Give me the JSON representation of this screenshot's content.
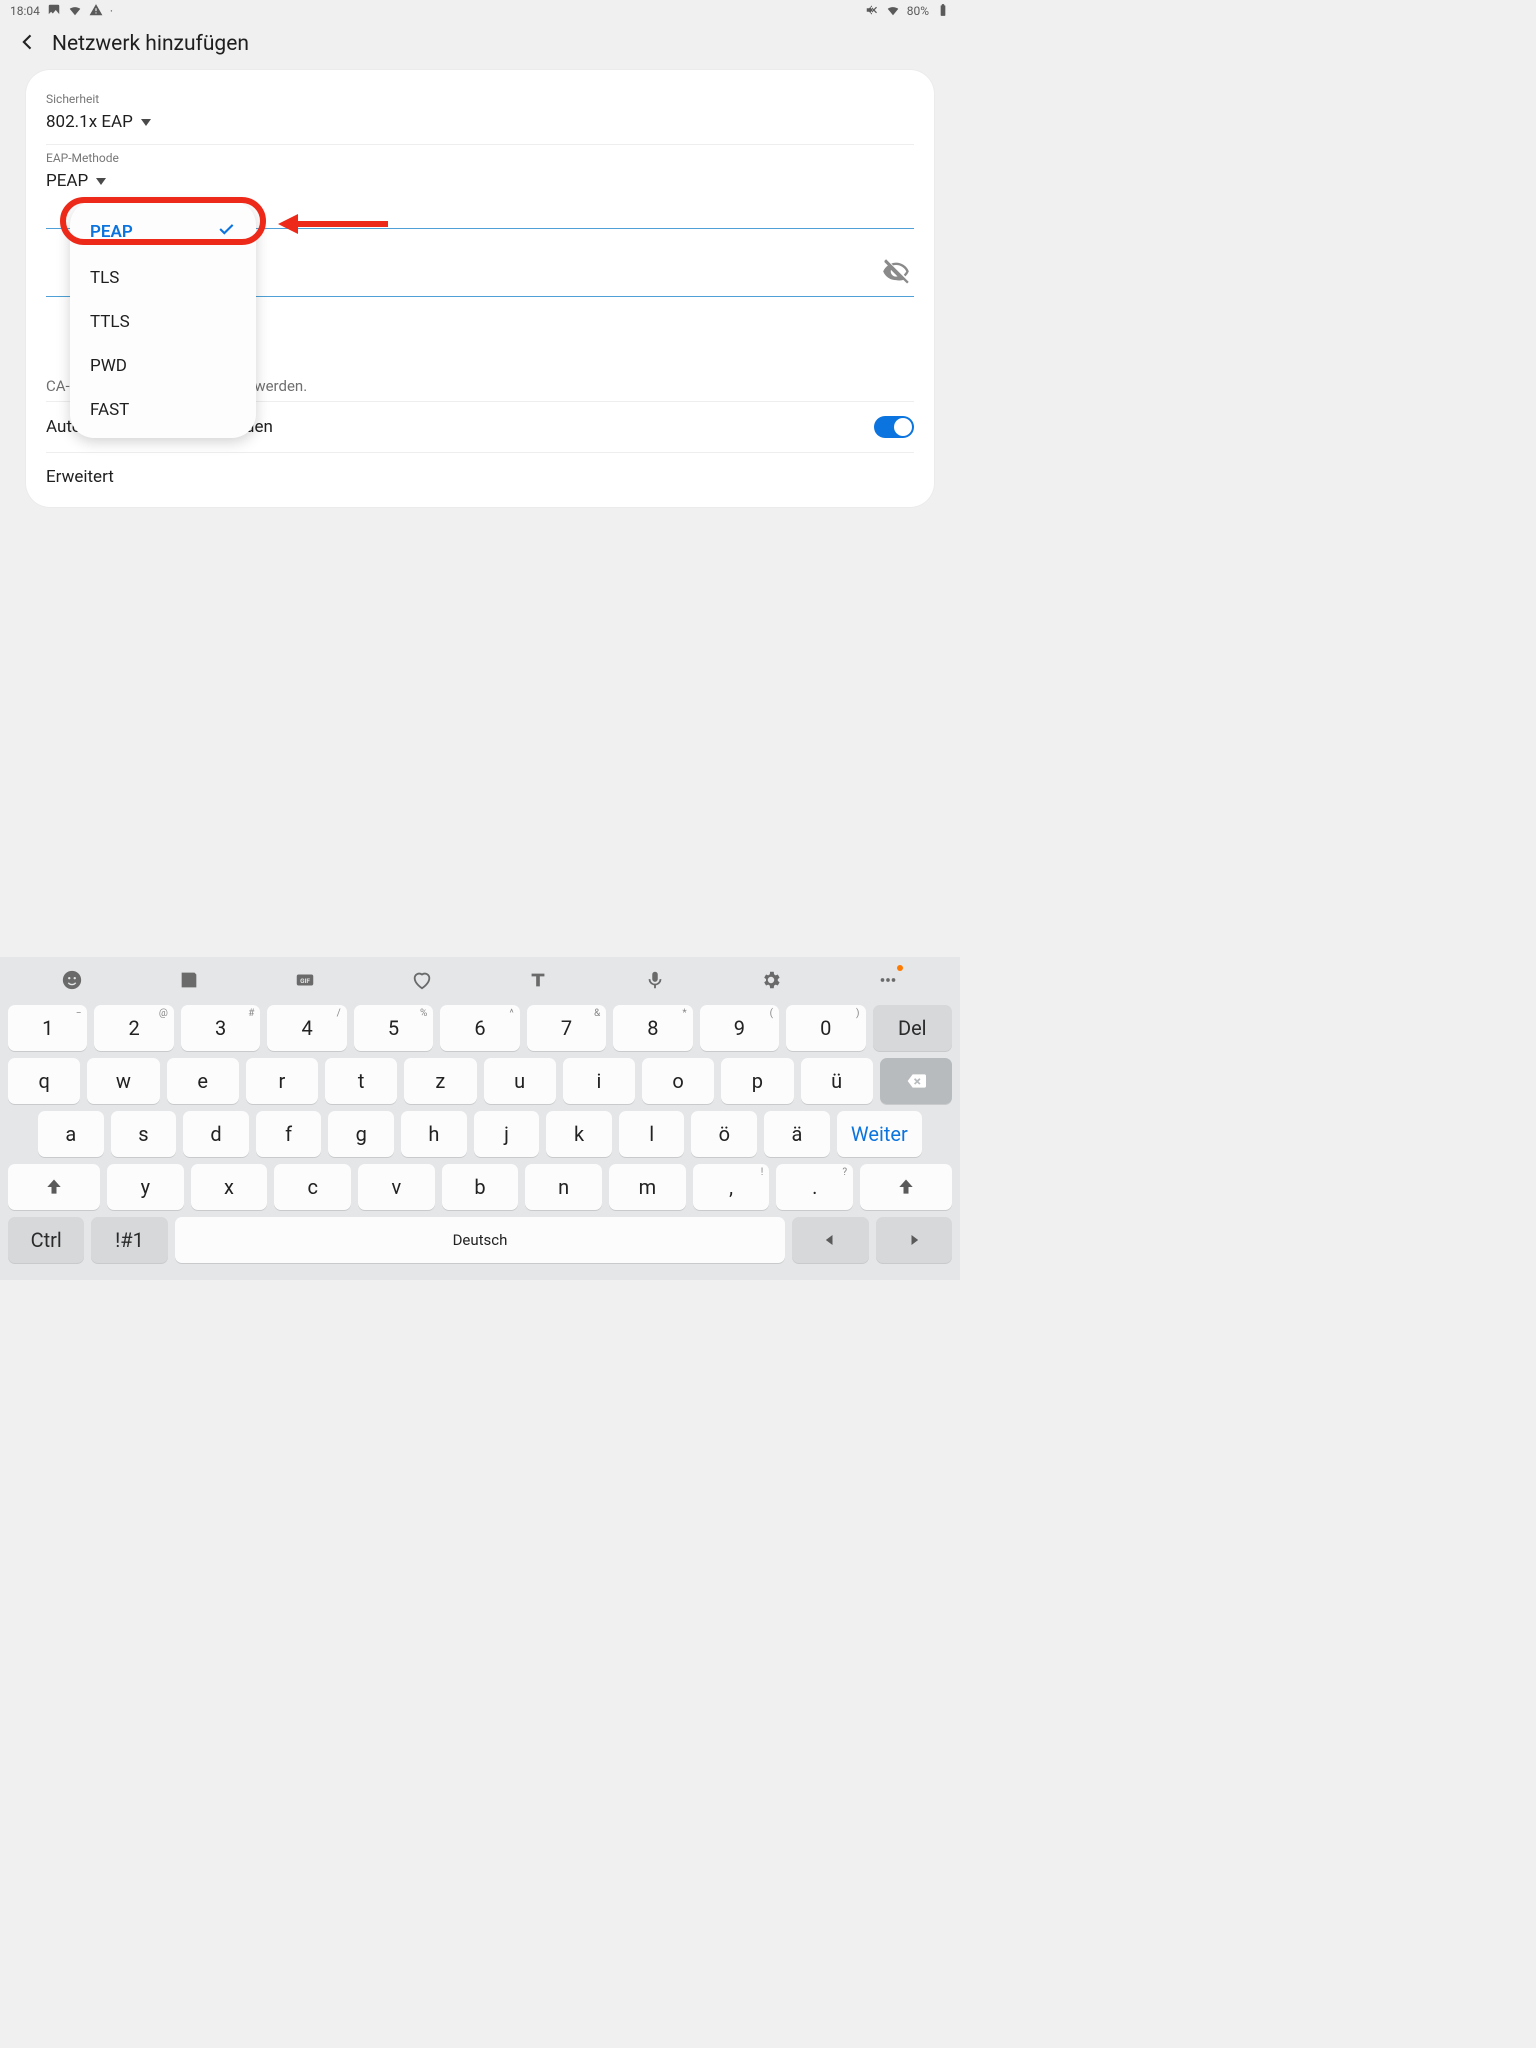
{
  "statusbar": {
    "time": "18:04",
    "battery_pct": "80%"
  },
  "header": {
    "title": "Netzwerk hinzufügen"
  },
  "form": {
    "security_label": "Sicherheit",
    "security_value": "802.1x EAP",
    "eap_method_label": "EAP-Methode",
    "eap_method_value": "PEAP",
    "cert_warning": "CA-Zertifikat muss ausgewählt werden.",
    "auto_reconnect_label": "Automatisch erneut verbinden",
    "auto_reconnect_on": true,
    "advanced_label": "Erweitert"
  },
  "dropdown": {
    "items": [
      "PEAP",
      "TLS",
      "TTLS",
      "PWD",
      "FAST"
    ],
    "selected": "PEAP"
  },
  "keyboard": {
    "row_num": [
      {
        "k": "1",
        "s": "−"
      },
      {
        "k": "2",
        "s": "@"
      },
      {
        "k": "3",
        "s": "#"
      },
      {
        "k": "4",
        "s": "/"
      },
      {
        "k": "5",
        "s": "%"
      },
      {
        "k": "6",
        "s": "^"
      },
      {
        "k": "7",
        "s": "&"
      },
      {
        "k": "8",
        "s": "*"
      },
      {
        "k": "9",
        "s": "("
      },
      {
        "k": "0",
        "s": ")"
      }
    ],
    "row_a": [
      "q",
      "w",
      "e",
      "r",
      "t",
      "z",
      "u",
      "i",
      "o",
      "p",
      "ü"
    ],
    "row_b": [
      "a",
      "s",
      "d",
      "f",
      "g",
      "h",
      "j",
      "k",
      "l",
      "ö",
      "ä"
    ],
    "row_c": [
      "y",
      "x",
      "c",
      "v",
      "b",
      "n",
      "m"
    ],
    "punct": [
      {
        "k": ",",
        "s": "!"
      },
      {
        "k": ".",
        "s": "?"
      }
    ],
    "del_label": "Del",
    "weiter_label": "Weiter",
    "ctrl_label": "Ctrl",
    "sym_label": "!#1",
    "space_label": "Deutsch"
  }
}
